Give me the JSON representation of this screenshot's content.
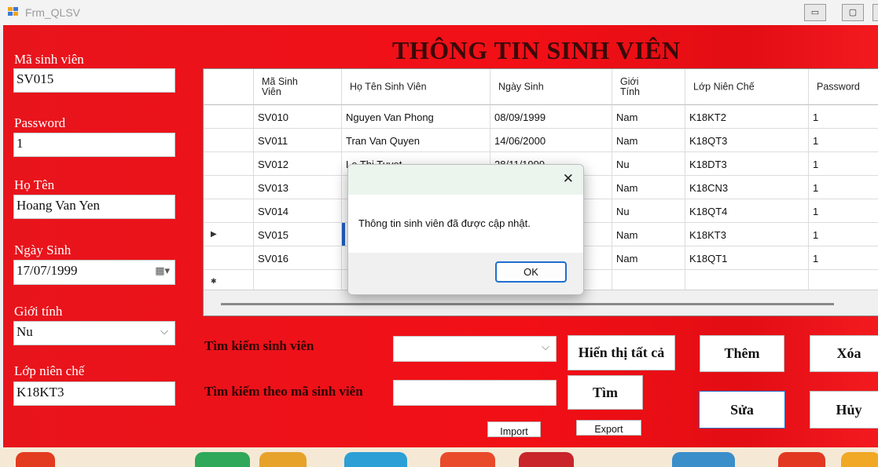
{
  "window": {
    "title": "Frm_QLSV",
    "minimize_glyph": "▭",
    "maximize_glyph": "▢"
  },
  "colors": {
    "form_background": "#ee1016",
    "window_titlebar": "#f3f3f3",
    "dialog_ok_border": "#1f6fd1"
  },
  "header": {
    "title": "THÔNG TIN SINH VIÊN"
  },
  "form": {
    "ma_sv": {
      "label": "Mã sinh viên",
      "value": "SV015"
    },
    "password": {
      "label": "Password",
      "value": "1"
    },
    "ho_ten": {
      "label": "Họ Tên",
      "value": "Hoang Van Yen"
    },
    "ngay_sinh": {
      "label": "Ngày Sinh",
      "value": "17/07/1999",
      "icon": "calendar-icon",
      "glyph": "▦▾"
    },
    "gioi_tinh": {
      "label": "Giới tính",
      "value": "Nu",
      "glyph": "⌵"
    },
    "lop": {
      "label": "Lớp niên chế",
      "value": "K18KT3"
    }
  },
  "grid": {
    "headers": [
      "Mã Sinh Viên",
      "Họ Tên Sinh Viên",
      "Ngày Sinh",
      "Giới Tính",
      "Lớp Niên Chế",
      "Password"
    ],
    "rows": [
      [
        "SV010",
        "Nguyen Van Phong",
        "08/09/1999",
        "Nam",
        "K18KT2",
        "1"
      ],
      [
        "SV011",
        "Tran Van Quyen",
        "14/06/2000",
        "Nam",
        "K18QT3",
        "1"
      ],
      [
        "SV012",
        "Le Thi Tuyet",
        "28/11/1999",
        "Nu",
        "K18DT3",
        "1"
      ],
      [
        "SV013",
        "",
        "",
        "Nam",
        "K18CN3",
        "1"
      ],
      [
        "SV014",
        "",
        "",
        "Nu",
        "K18QT4",
        "1"
      ],
      [
        "SV015",
        "",
        "",
        "Nam",
        "K18KT3",
        "1"
      ],
      [
        "SV016",
        "",
        "",
        "Nam",
        "K18QT1",
        "1"
      ]
    ],
    "current_row_glyph": "▶",
    "new_row_glyph": "✱"
  },
  "search": {
    "label1": "Tìm kiếm sinh viên",
    "label2": "Tìm kiếm theo mã sinh viên",
    "combo_value": "",
    "combo_glyph": "⌵",
    "text_value": ""
  },
  "buttons": {
    "show_all": "Hiển thị tất cả",
    "find": "Tìm",
    "add": "Thêm",
    "delete": "Xóa",
    "edit": "Sửa",
    "cancel": "Hủy",
    "import": "Import",
    "export": "Export"
  },
  "dialog": {
    "message": "Thông tin sinh viên đã được cập nhật.",
    "ok": "OK",
    "close_glyph": "✕"
  }
}
